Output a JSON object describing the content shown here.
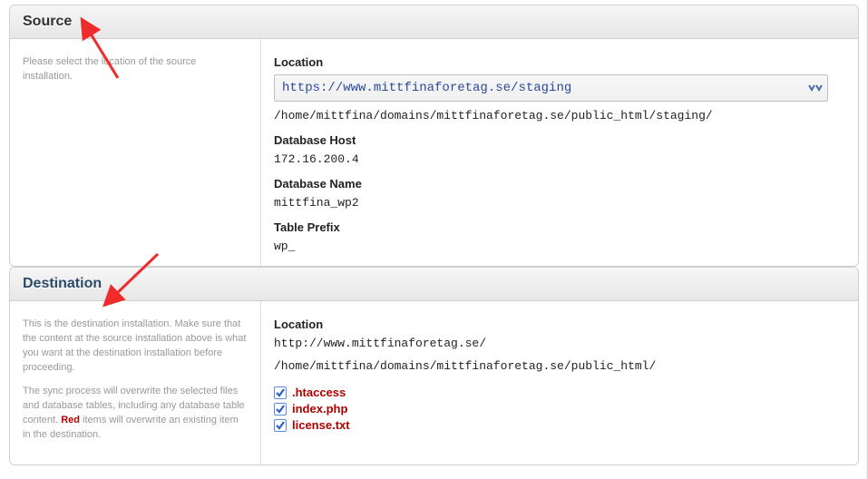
{
  "source": {
    "title": "Source",
    "help": "Please select the location of the source installation.",
    "location_label": "Location",
    "location_select": "https://www.mittfinaforetag.se/staging",
    "location_path": "/home/mittfina/domains/mittfinaforetag.se/public_html/staging/",
    "db_host_label": "Database Host",
    "db_host": "172.16.200.4",
    "db_name_label": "Database Name",
    "db_name": "mittfina_wp2",
    "table_prefix_label": "Table Prefix",
    "table_prefix": "wp_"
  },
  "destination": {
    "title": "Destination",
    "help1": "This is the destination installation. Make sure that the content at the source installation above is what you want at the destination installation before proceeding.",
    "help2_a": "The sync process will overwrite the selected files and database tables, including any database table content. ",
    "help2_red": "Red",
    "help2_b": " items will overwrite an existing item in the destination.",
    "location_label": "Location",
    "location_url": "http://www.mittfinaforetag.se/",
    "location_path": "/home/mittfina/domains/mittfinaforetag.se/public_html/",
    "files": [
      {
        "name": ".htaccess",
        "checked": true
      },
      {
        "name": "index.php",
        "checked": true
      },
      {
        "name": "license.txt",
        "checked": true
      }
    ]
  }
}
